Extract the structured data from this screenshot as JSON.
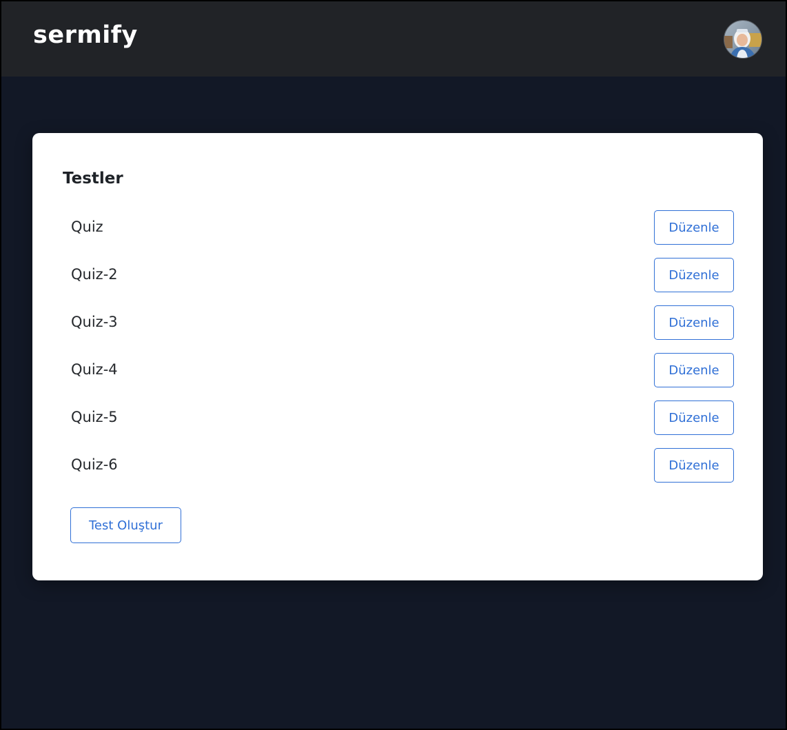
{
  "navbar": {
    "brand": "sermify",
    "avatar_icon": "user-avatar-photo"
  },
  "colors": {
    "navbar_bg": "#212327",
    "page_bg": "#121826",
    "card_bg": "#ffffff",
    "accent": "#2f6fd6"
  },
  "card": {
    "title": "Testler",
    "quizzes": [
      {
        "name": "Quiz",
        "edit_label": "Düzenle"
      },
      {
        "name": "Quiz-2",
        "edit_label": "Düzenle"
      },
      {
        "name": "Quiz-3",
        "edit_label": "Düzenle"
      },
      {
        "name": "Quiz-4",
        "edit_label": "Düzenle"
      },
      {
        "name": "Quiz-5",
        "edit_label": "Düzenle"
      },
      {
        "name": "Quiz-6",
        "edit_label": "Düzenle"
      }
    ],
    "create_label": "Test Oluştur"
  }
}
